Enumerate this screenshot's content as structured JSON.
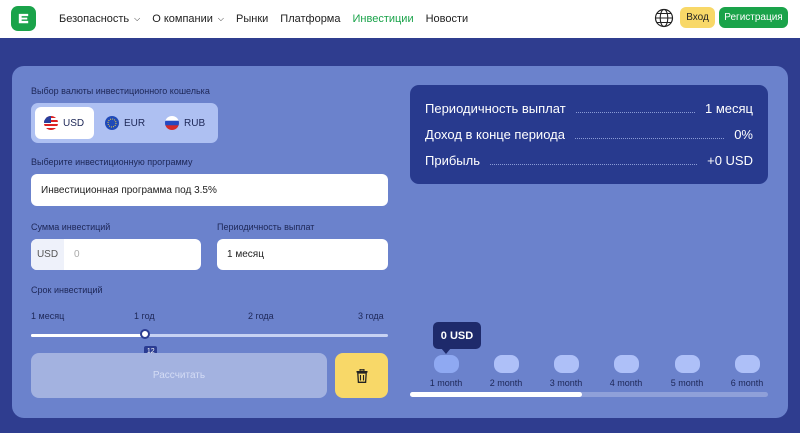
{
  "nav": {
    "items": [
      {
        "label": "Безопасность",
        "dropdown": true
      },
      {
        "label": "О компании",
        "dropdown": true
      },
      {
        "label": "Рынки",
        "dropdown": false
      },
      {
        "label": "Платформа",
        "dropdown": false
      },
      {
        "label": "Инвестиции",
        "dropdown": false,
        "active": true
      },
      {
        "label": "Новости",
        "dropdown": false
      }
    ],
    "login_label": "Вход",
    "register_label": "Регистрация"
  },
  "form": {
    "currency_label": "Выбор валюты инвестиционного кошелька",
    "currencies": [
      {
        "code": "USD",
        "selected": true
      },
      {
        "code": "EUR",
        "selected": false
      },
      {
        "code": "RUB",
        "selected": false
      }
    ],
    "program_label": "Выберите инвестиционную программу",
    "program_value": "Инвестиционная программа под 3.5%",
    "amount_label": "Сумма инвестиций",
    "amount_prefix": "USD",
    "amount_placeholder": "0",
    "payout_label": "Периодичность выплат",
    "payout_value": "1 месяц",
    "term_label": "Срок инвестиций",
    "term_ticks": [
      "1 месяц",
      "1 год",
      "2 года",
      "3 года"
    ],
    "term_slider_value": "12",
    "term_slider_fraction": 0.32,
    "calculate_label": "Рассчитать"
  },
  "summary": {
    "rows": [
      {
        "label": "Периодичность выплат",
        "value": "1 месяц"
      },
      {
        "label": "Доход в конце периода",
        "value": "0%"
      },
      {
        "label": "Прибыль",
        "value": "+0 USD"
      }
    ]
  },
  "timeline": {
    "tooltip": "0 USD",
    "months": [
      "1 month",
      "2 month",
      "3 month",
      "4 month",
      "5 month",
      "6 month"
    ],
    "scroll_fraction": 0.48
  },
  "colors": {
    "brand": "#1aa34a",
    "background": "#2f3d8f",
    "card": "#6b82cc",
    "accent_yellow": "#f8d868"
  }
}
